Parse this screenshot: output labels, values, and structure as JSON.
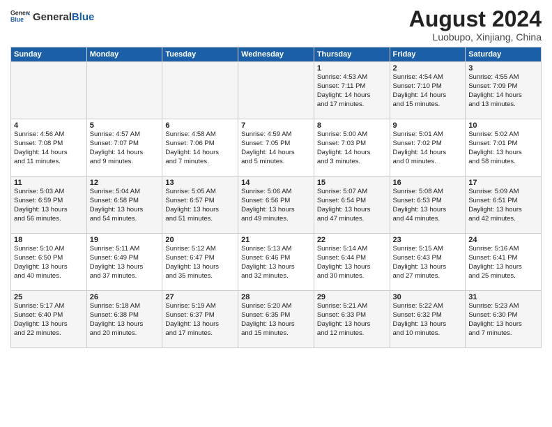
{
  "header": {
    "logo_general": "General",
    "logo_blue": "Blue",
    "month_year": "August 2024",
    "location": "Luobupo, Xinjiang, China"
  },
  "days_of_week": [
    "Sunday",
    "Monday",
    "Tuesday",
    "Wednesday",
    "Thursday",
    "Friday",
    "Saturday"
  ],
  "weeks": [
    [
      {
        "day": "",
        "text": ""
      },
      {
        "day": "",
        "text": ""
      },
      {
        "day": "",
        "text": ""
      },
      {
        "day": "",
        "text": ""
      },
      {
        "day": "1",
        "text": "Sunrise: 4:53 AM\nSunset: 7:11 PM\nDaylight: 14 hours\nand 17 minutes."
      },
      {
        "day": "2",
        "text": "Sunrise: 4:54 AM\nSunset: 7:10 PM\nDaylight: 14 hours\nand 15 minutes."
      },
      {
        "day": "3",
        "text": "Sunrise: 4:55 AM\nSunset: 7:09 PM\nDaylight: 14 hours\nand 13 minutes."
      }
    ],
    [
      {
        "day": "4",
        "text": "Sunrise: 4:56 AM\nSunset: 7:08 PM\nDaylight: 14 hours\nand 11 minutes."
      },
      {
        "day": "5",
        "text": "Sunrise: 4:57 AM\nSunset: 7:07 PM\nDaylight: 14 hours\nand 9 minutes."
      },
      {
        "day": "6",
        "text": "Sunrise: 4:58 AM\nSunset: 7:06 PM\nDaylight: 14 hours\nand 7 minutes."
      },
      {
        "day": "7",
        "text": "Sunrise: 4:59 AM\nSunset: 7:05 PM\nDaylight: 14 hours\nand 5 minutes."
      },
      {
        "day": "8",
        "text": "Sunrise: 5:00 AM\nSunset: 7:03 PM\nDaylight: 14 hours\nand 3 minutes."
      },
      {
        "day": "9",
        "text": "Sunrise: 5:01 AM\nSunset: 7:02 PM\nDaylight: 14 hours\nand 0 minutes."
      },
      {
        "day": "10",
        "text": "Sunrise: 5:02 AM\nSunset: 7:01 PM\nDaylight: 13 hours\nand 58 minutes."
      }
    ],
    [
      {
        "day": "11",
        "text": "Sunrise: 5:03 AM\nSunset: 6:59 PM\nDaylight: 13 hours\nand 56 minutes."
      },
      {
        "day": "12",
        "text": "Sunrise: 5:04 AM\nSunset: 6:58 PM\nDaylight: 13 hours\nand 54 minutes."
      },
      {
        "day": "13",
        "text": "Sunrise: 5:05 AM\nSunset: 6:57 PM\nDaylight: 13 hours\nand 51 minutes."
      },
      {
        "day": "14",
        "text": "Sunrise: 5:06 AM\nSunset: 6:56 PM\nDaylight: 13 hours\nand 49 minutes."
      },
      {
        "day": "15",
        "text": "Sunrise: 5:07 AM\nSunset: 6:54 PM\nDaylight: 13 hours\nand 47 minutes."
      },
      {
        "day": "16",
        "text": "Sunrise: 5:08 AM\nSunset: 6:53 PM\nDaylight: 13 hours\nand 44 minutes."
      },
      {
        "day": "17",
        "text": "Sunrise: 5:09 AM\nSunset: 6:51 PM\nDaylight: 13 hours\nand 42 minutes."
      }
    ],
    [
      {
        "day": "18",
        "text": "Sunrise: 5:10 AM\nSunset: 6:50 PM\nDaylight: 13 hours\nand 40 minutes."
      },
      {
        "day": "19",
        "text": "Sunrise: 5:11 AM\nSunset: 6:49 PM\nDaylight: 13 hours\nand 37 minutes."
      },
      {
        "day": "20",
        "text": "Sunrise: 5:12 AM\nSunset: 6:47 PM\nDaylight: 13 hours\nand 35 minutes."
      },
      {
        "day": "21",
        "text": "Sunrise: 5:13 AM\nSunset: 6:46 PM\nDaylight: 13 hours\nand 32 minutes."
      },
      {
        "day": "22",
        "text": "Sunrise: 5:14 AM\nSunset: 6:44 PM\nDaylight: 13 hours\nand 30 minutes."
      },
      {
        "day": "23",
        "text": "Sunrise: 5:15 AM\nSunset: 6:43 PM\nDaylight: 13 hours\nand 27 minutes."
      },
      {
        "day": "24",
        "text": "Sunrise: 5:16 AM\nSunset: 6:41 PM\nDaylight: 13 hours\nand 25 minutes."
      }
    ],
    [
      {
        "day": "25",
        "text": "Sunrise: 5:17 AM\nSunset: 6:40 PM\nDaylight: 13 hours\nand 22 minutes."
      },
      {
        "day": "26",
        "text": "Sunrise: 5:18 AM\nSunset: 6:38 PM\nDaylight: 13 hours\nand 20 minutes."
      },
      {
        "day": "27",
        "text": "Sunrise: 5:19 AM\nSunset: 6:37 PM\nDaylight: 13 hours\nand 17 minutes."
      },
      {
        "day": "28",
        "text": "Sunrise: 5:20 AM\nSunset: 6:35 PM\nDaylight: 13 hours\nand 15 minutes."
      },
      {
        "day": "29",
        "text": "Sunrise: 5:21 AM\nSunset: 6:33 PM\nDaylight: 13 hours\nand 12 minutes."
      },
      {
        "day": "30",
        "text": "Sunrise: 5:22 AM\nSunset: 6:32 PM\nDaylight: 13 hours\nand 10 minutes."
      },
      {
        "day": "31",
        "text": "Sunrise: 5:23 AM\nSunset: 6:30 PM\nDaylight: 13 hours\nand 7 minutes."
      }
    ]
  ]
}
